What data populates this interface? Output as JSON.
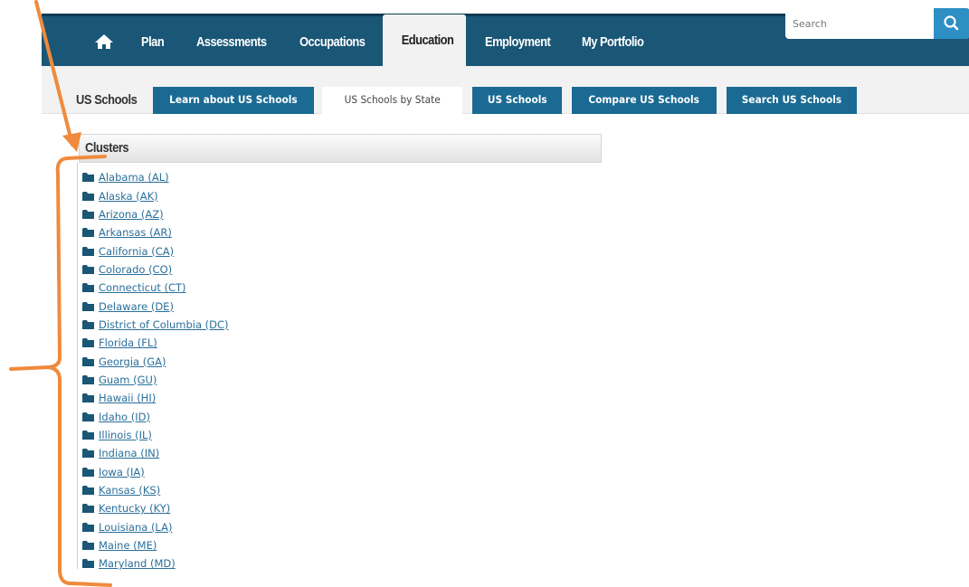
{
  "navbar": {
    "items": [
      {
        "label": "Plan"
      },
      {
        "label": "Assessments"
      },
      {
        "label": "Occupations"
      },
      {
        "label": "Education"
      },
      {
        "label": "Employment"
      },
      {
        "label": "My Portfolio"
      }
    ],
    "search_placeholder": "Search"
  },
  "subnav": {
    "title": "US Schools",
    "tabs": [
      {
        "label": "Learn about US Schools"
      },
      {
        "label": "US Schools by State"
      },
      {
        "label": "US Schools"
      },
      {
        "label": "Compare US Schools"
      },
      {
        "label": "Search US Schools"
      }
    ],
    "selected_tab": "US Schools by State"
  },
  "clusters": {
    "title": "Clusters",
    "states": [
      "Alabama (AL)",
      "Alaska (AK)",
      "Arizona (AZ)",
      "Arkansas (AR)",
      "California (CA)",
      "Colorado (CO)",
      "Connecticut (CT)",
      "Delaware (DE)",
      "District of Columbia (DC)",
      "Florida (FL)",
      "Georgia (GA)",
      "Guam (GU)",
      "Hawaii (HI)",
      "Idaho (ID)",
      "Illinois (IL)",
      "Indiana (IN)",
      "Iowa (IA)",
      "Kansas (KS)",
      "Kentucky (KY)",
      "Louisiana (LA)",
      "Maine (ME)",
      "Maryland (MD)"
    ]
  },
  "colors": {
    "navbar": "#1a5676",
    "tab": "#1a6a93",
    "link": "#2a6f9b",
    "annotation": "#f08a3c"
  }
}
